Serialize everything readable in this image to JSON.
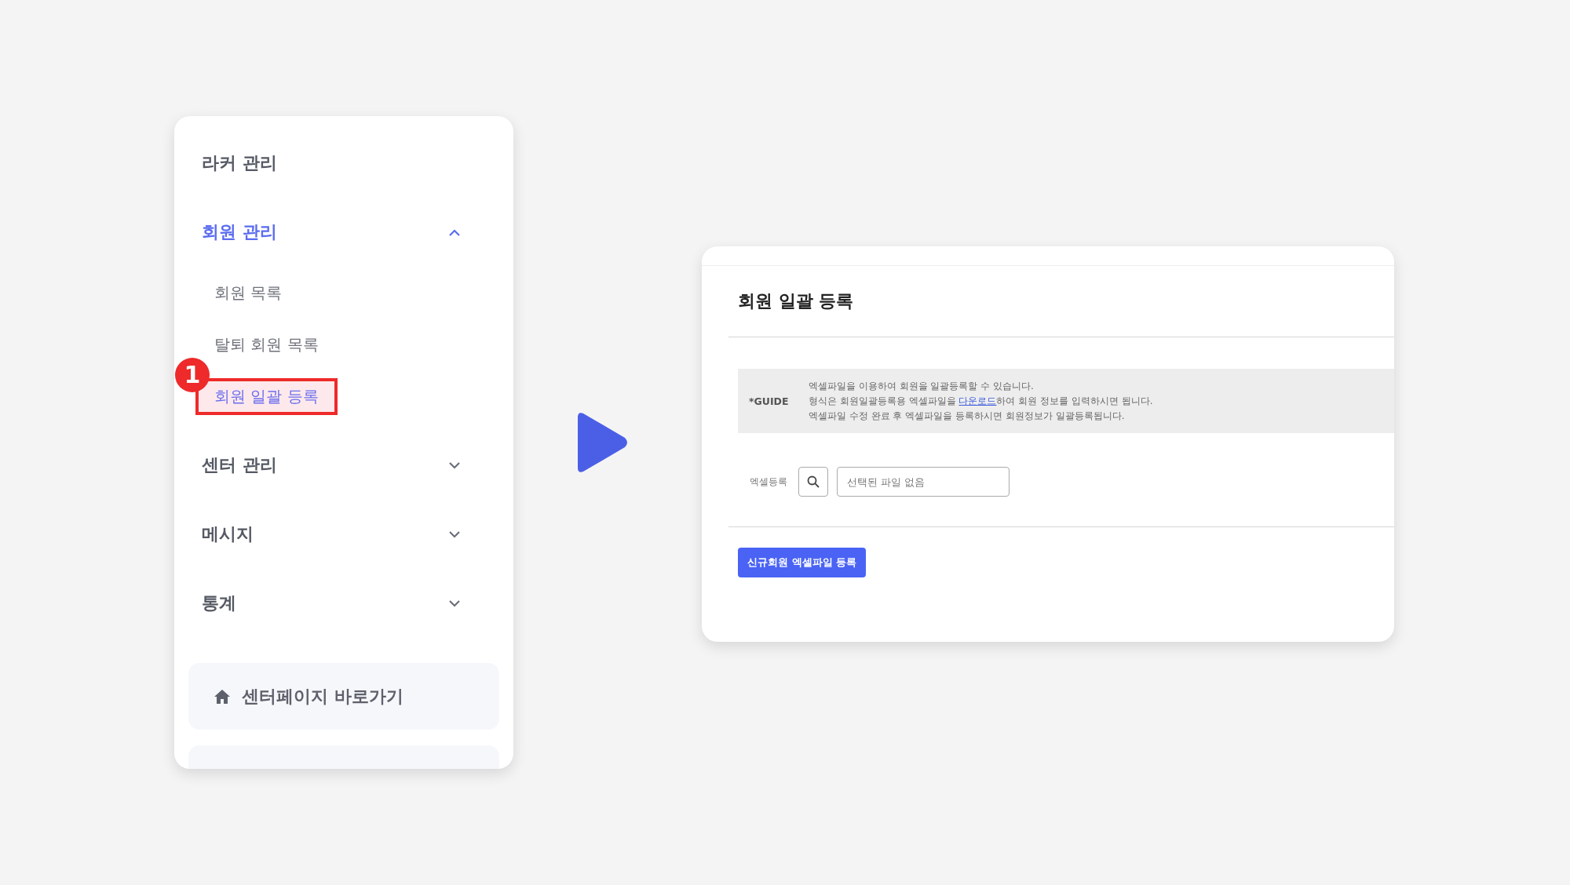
{
  "sidebar": {
    "items": [
      {
        "kind": "plain",
        "label": "라커 관리",
        "expanded": false
      },
      {
        "kind": "group",
        "label": "회원 관리",
        "expanded": true,
        "children": [
          {
            "label": "회원 목록",
            "selected": false
          },
          {
            "label": "탈퇴 회원 목록",
            "selected": false
          },
          {
            "label": "회원 일괄 등록",
            "selected": true,
            "annotation": "1"
          }
        ]
      },
      {
        "kind": "group",
        "label": "센터 관리",
        "expanded": false
      },
      {
        "kind": "group",
        "label": "메시지",
        "expanded": false
      },
      {
        "kind": "group",
        "label": "통계",
        "expanded": false
      }
    ],
    "shortcut": {
      "label": "센터페이지 바로가기"
    }
  },
  "panel": {
    "title": "회원 일괄 등록",
    "guide": {
      "label": "*GUIDE",
      "lines": [
        {
          "text": "엑셀파일을 이용하여 회원을 일괄등록할 수 있습니다."
        },
        {
          "text": "형식은 회원일괄등록용 엑셀파일을 ",
          "link": "다운로드",
          "after": "하여 회원 정보를 입력하시면 됩니다."
        },
        {
          "text": "엑셀파일 수정 완료 후 엑셀파일을 등록하시면 회원정보가 일괄등록됩니다."
        }
      ]
    },
    "field": {
      "label": "엑셀등록",
      "placeholder": "선택된 파일 없음"
    },
    "button": "신규회원 엑셀파일 등록"
  }
}
